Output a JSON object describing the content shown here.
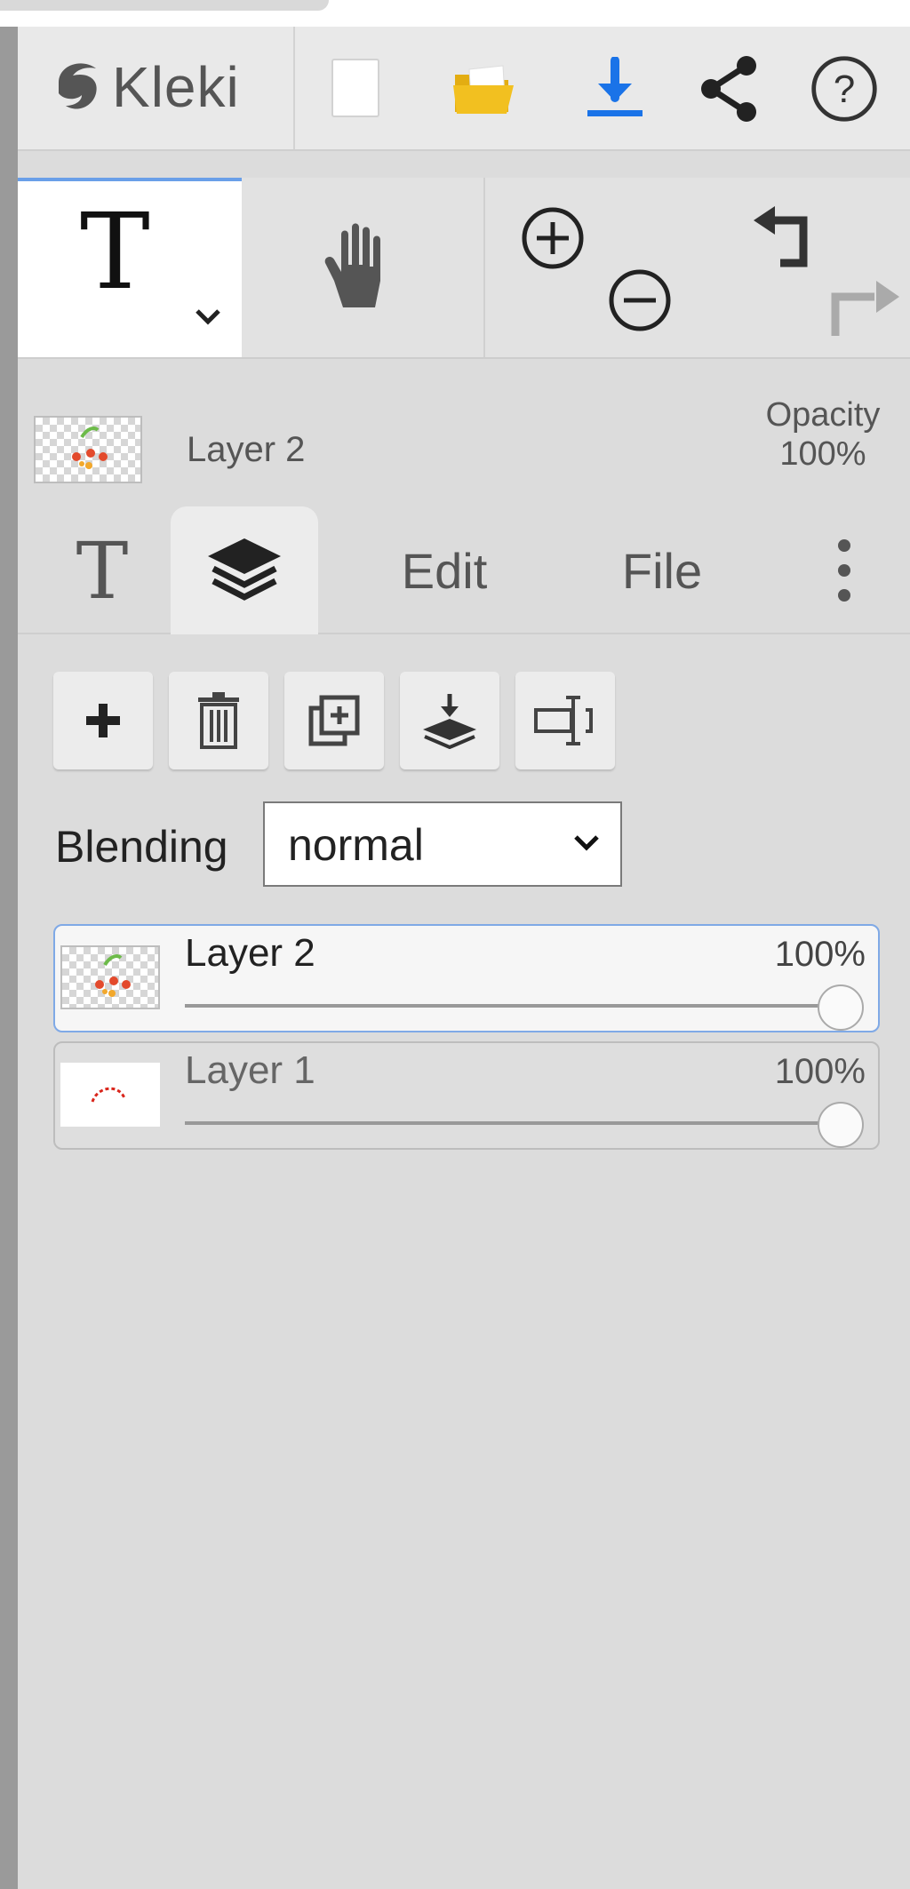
{
  "header": {
    "app_name": "Kleki",
    "icons": [
      "new-image-icon",
      "open-folder-icon",
      "download-icon",
      "share-icon",
      "help-icon"
    ],
    "accent_blue": "#1a73e8",
    "folder_yellow": "#f2c020"
  },
  "tools": {
    "active_tool": "T",
    "hand_tool_icon": "hand-icon",
    "zoom_icons": [
      "zoom-in-icon",
      "zoom-out-icon"
    ],
    "history_icons": [
      "undo-icon",
      "redo-icon"
    ]
  },
  "layer_info": {
    "name": "Layer 2",
    "opacity_label": "Opacity",
    "opacity_value": "100%"
  },
  "tabs": {
    "text_tab": "T",
    "layers_tab_icon": "layers-icon",
    "edit": "Edit",
    "file": "File",
    "more_icon": "more-vertical-icon"
  },
  "layer_actions": [
    "add-layer-icon",
    "delete-layer-icon",
    "duplicate-layer-icon",
    "merge-down-icon",
    "rename-layer-icon"
  ],
  "blending": {
    "label": "Blending",
    "value": "normal"
  },
  "layers": [
    {
      "name": "Layer 2",
      "opacity": "100%",
      "opacity_value": 1.0,
      "active": true
    },
    {
      "name": "Layer 1",
      "opacity": "100%",
      "opacity_value": 1.0,
      "active": false
    }
  ]
}
